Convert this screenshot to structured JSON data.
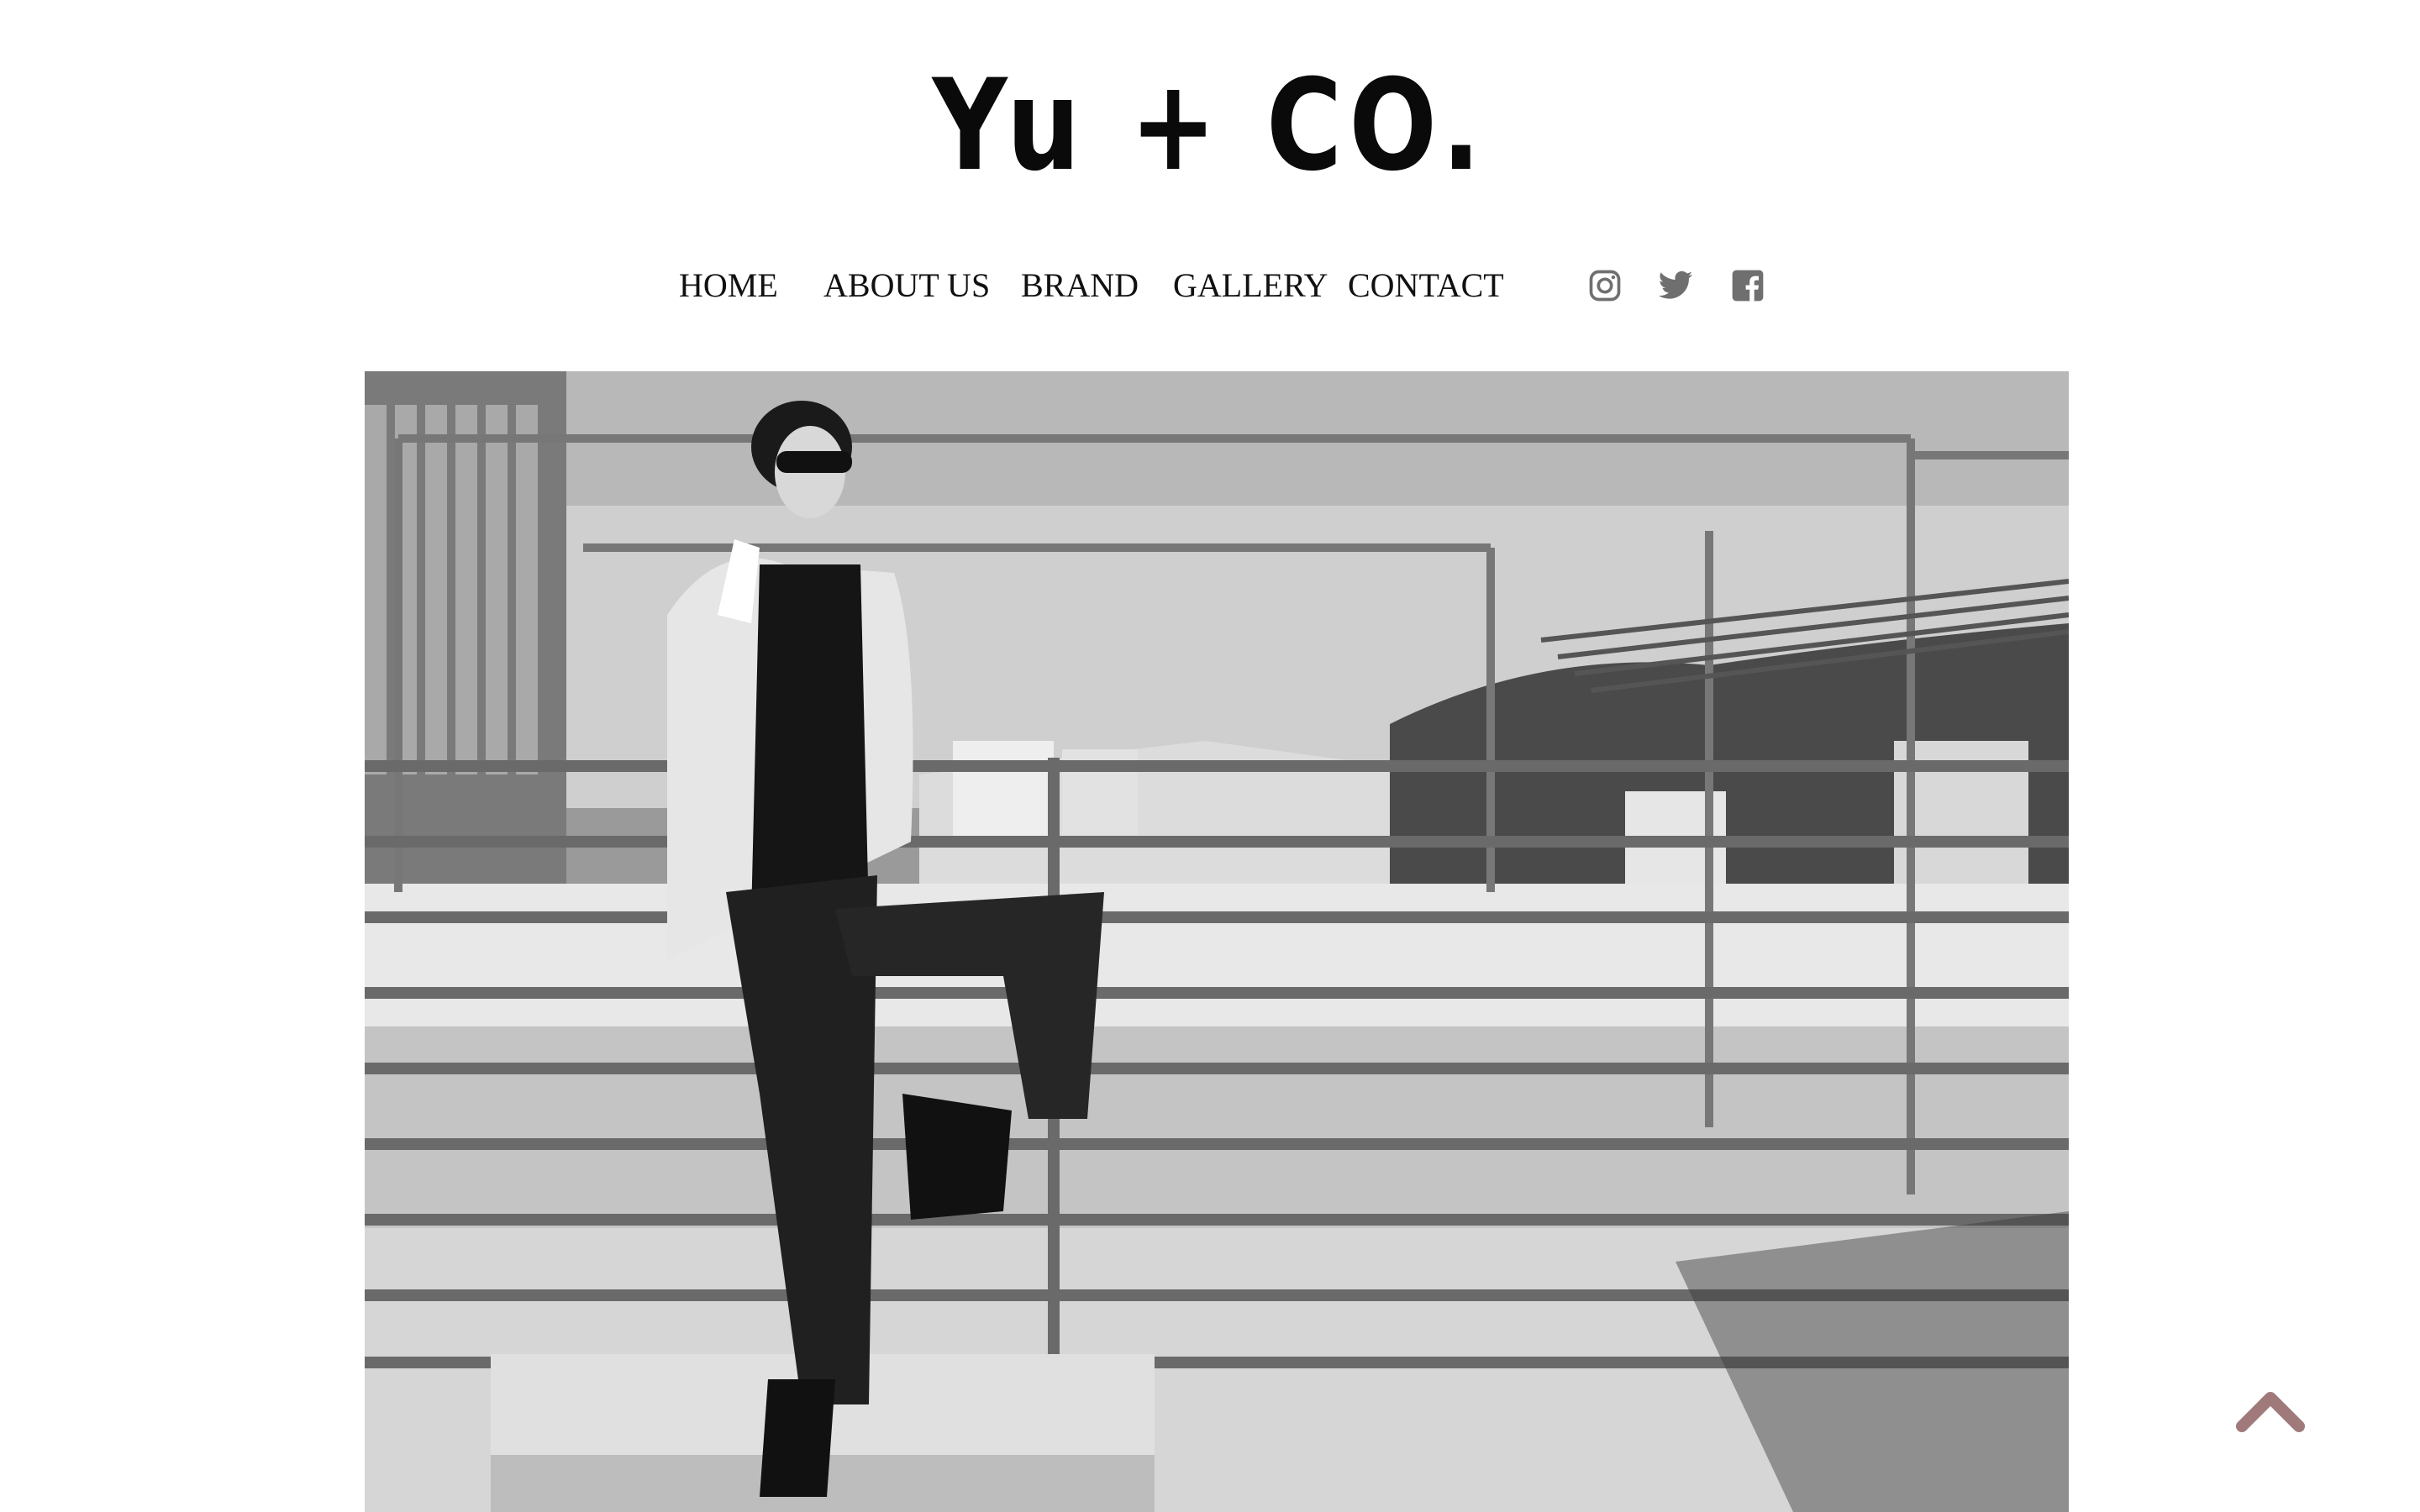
{
  "brand": {
    "logo_text": "Yu + CO."
  },
  "nav": {
    "items": [
      {
        "label": "HOME"
      },
      {
        "label": "ABOUT US"
      },
      {
        "label": "BRAND"
      },
      {
        "label": "GALLERY"
      },
      {
        "label": "CONTACT"
      }
    ]
  },
  "social": {
    "icons": [
      "instagram-icon",
      "twitter-icon",
      "facebook-icon"
    ],
    "color": "#6f6f6f"
  },
  "hero": {
    "subject": "black-and-white fashion photo of a woman posing on a rooftop railing"
  },
  "scroll_top": {
    "icon": "chevron-up-icon",
    "color": "#a07a7a"
  }
}
